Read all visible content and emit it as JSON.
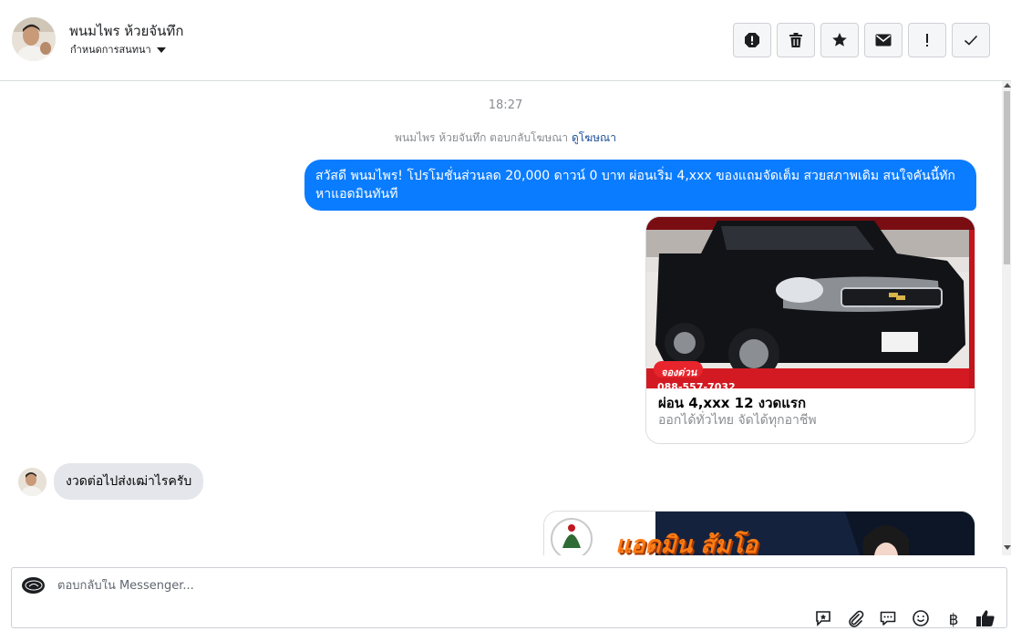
{
  "header": {
    "contact_name": "พนมไพร ห้วยจันทึก",
    "conversation_status": "กำหนดการสนทนา",
    "toolbar": [
      "spam-icon",
      "trash-icon",
      "star-icon",
      "envelope-icon",
      "exclamation-icon",
      "checkmark-icon"
    ]
  },
  "thread": {
    "timestamp": "18:27",
    "ad_reply_prefix": "พนมไพร ห้วยจันทึก ตอบกลับโฆษณา",
    "ad_reply_link": "ดูโฆษณา",
    "outgoing_message": "สวัสดี พนมไพร! โปรโมชั่นส่วนลด 20,000 ดาวน์ 0 บาท ผ่อนเริ่ม 4,xxx  ของแถมจัดเต็ม สวยสภาพเดิม สนใจคันนี้ทักหาแอดมินทันที",
    "ad_card": {
      "badge": "จองด่วน",
      "phone": "088-557-7032",
      "title": "ผ่อน 4,xxx 12 งวดแรก",
      "subtitle": "ออกได้ทั่วไทย จัดได้ทุกอาชีพ"
    },
    "incoming_message": "งวดต่อไปส่งเฒ่าไรครับ",
    "banner_text": "แอดมิน ส้มโอ"
  },
  "composer": {
    "placeholder": "ตอบกลับใน Messenger...",
    "baht_symbol": "฿",
    "icons": [
      "saved-reply-icon",
      "paperclip-icon",
      "chat-bubble-icon",
      "smiley-icon",
      "baht-icon",
      "thumbs-up-icon"
    ]
  },
  "colors": {
    "outgoing_bubble": "#0a7cff",
    "incoming_bubble": "#e4e6eb",
    "link": "#1c4d99"
  }
}
